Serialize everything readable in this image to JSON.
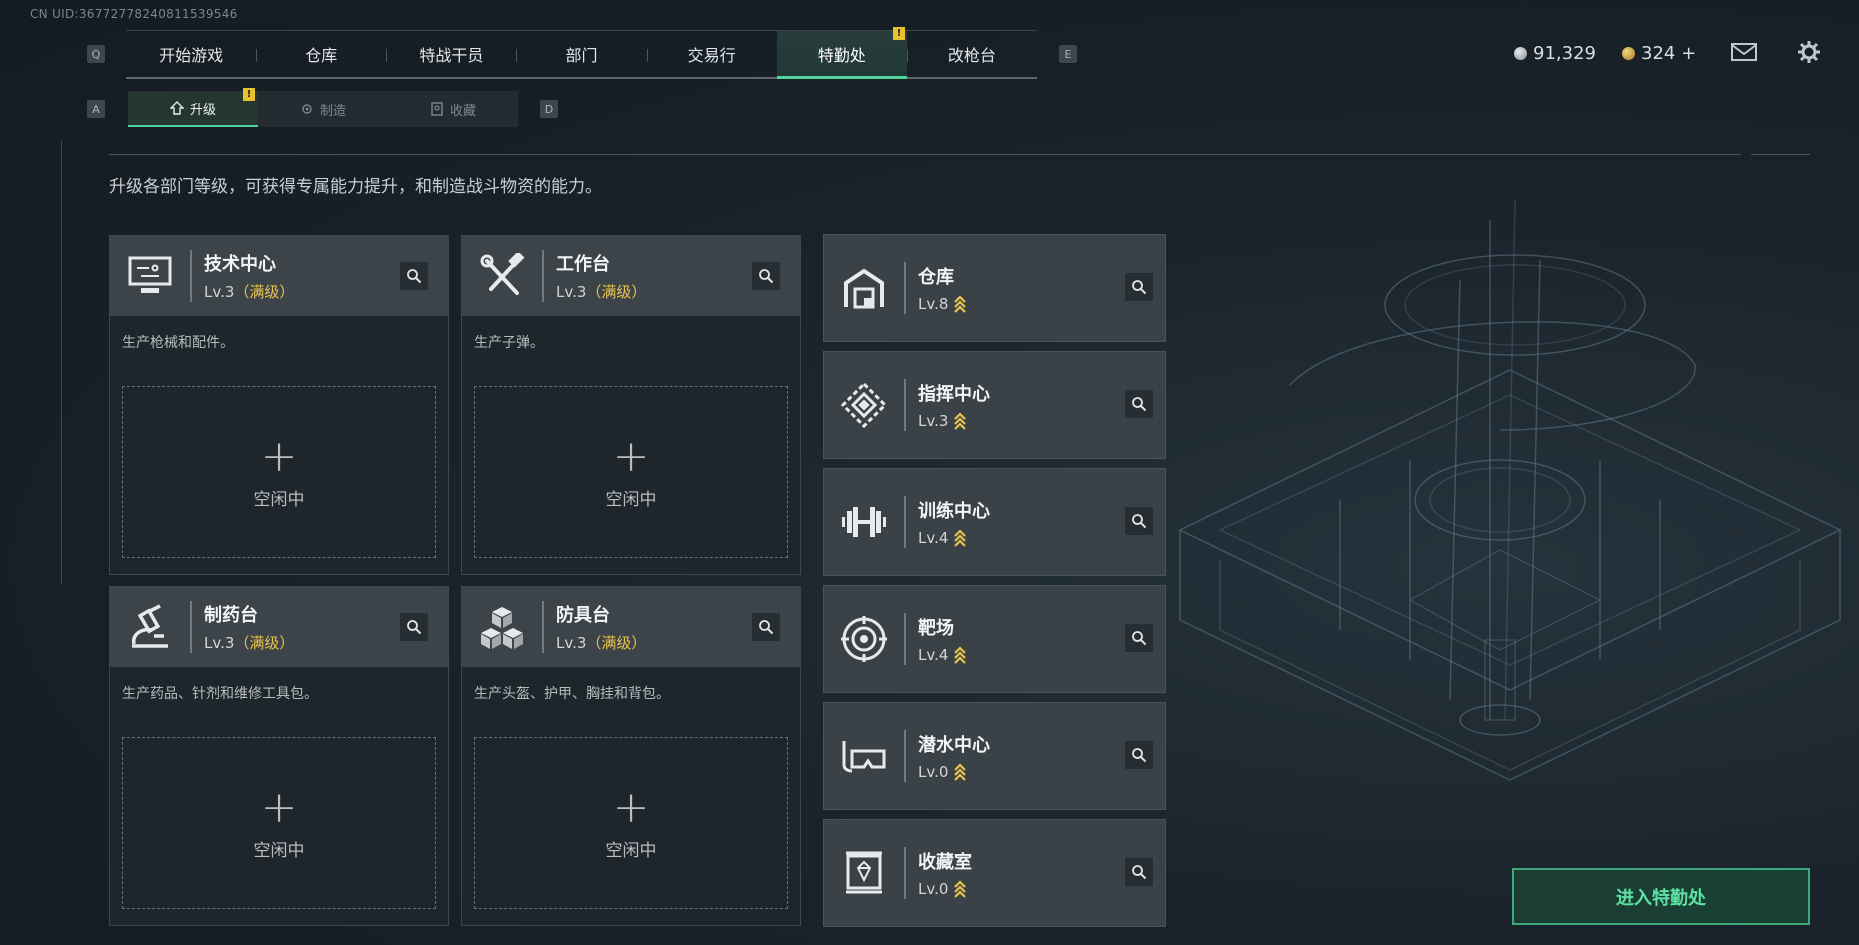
{
  "uid": "CN UID:3677277824081153954​6",
  "topnav": {
    "left_key": "Q",
    "right_key": "E",
    "tabs": [
      "开始游戏",
      "仓库",
      "特战干员",
      "部门",
      "交易行",
      "特勤处",
      "改枪台"
    ],
    "active_tab": "特勤处"
  },
  "currency": {
    "coins": "91,329",
    "premium": "324 +"
  },
  "subnav": {
    "left_key": "A",
    "right_key": "D",
    "tabs": [
      {
        "label": "升级",
        "icon": "upgrade-icon",
        "active": true
      },
      {
        "label": "制造",
        "icon": "craft-icon",
        "active": false
      },
      {
        "label": "收藏",
        "icon": "collection-icon",
        "active": false
      }
    ]
  },
  "description": "升级各部门等级，可获得专属能力提升，和制造战斗物资的能力。",
  "stations": [
    {
      "name": "技术中心",
      "level": "Lv.3",
      "max": "（满级）",
      "desc": "生产枪械和配件。",
      "slot_plus": "+",
      "slot_status": "空闲中",
      "icon": "computer-icon"
    },
    {
      "name": "工作台",
      "level": "Lv.3",
      "max": "（满级）",
      "desc": "生产子弹。",
      "slot_plus": "+",
      "slot_status": "空闲中",
      "icon": "tools-icon"
    },
    {
      "name": "制药台",
      "level": "Lv.3",
      "max": "（满级）",
      "desc": "生产药品、针剂和维修工具包。",
      "slot_plus": "+",
      "slot_status": "空闲中",
      "icon": "microscope-icon"
    },
    {
      "name": "防具台",
      "level": "Lv.3",
      "max": "（满级）",
      "desc": "生产头盔、护甲、胸挂和背包。",
      "slot_plus": "+",
      "slot_status": "空闲中",
      "icon": "cubes-icon"
    }
  ],
  "departments": [
    {
      "name": "仓库",
      "level": "Lv.8",
      "icon": "warehouse-icon"
    },
    {
      "name": "指挥中心",
      "level": "Lv.3",
      "icon": "command-icon"
    },
    {
      "name": "训练中心",
      "level": "Lv.4",
      "icon": "dumbbell-icon"
    },
    {
      "name": "靶场",
      "level": "Lv.4",
      "icon": "target-icon"
    },
    {
      "name": "潜水中心",
      "level": "Lv.0",
      "icon": "diving-mask-icon"
    },
    {
      "name": "收藏室",
      "level": "Lv.0",
      "icon": "display-case-icon"
    }
  ],
  "enter_button": "进入特勤处",
  "colors": {
    "accent": "#4fd39a",
    "max_level": "#e8c44a",
    "warning": "#e8c12e"
  }
}
